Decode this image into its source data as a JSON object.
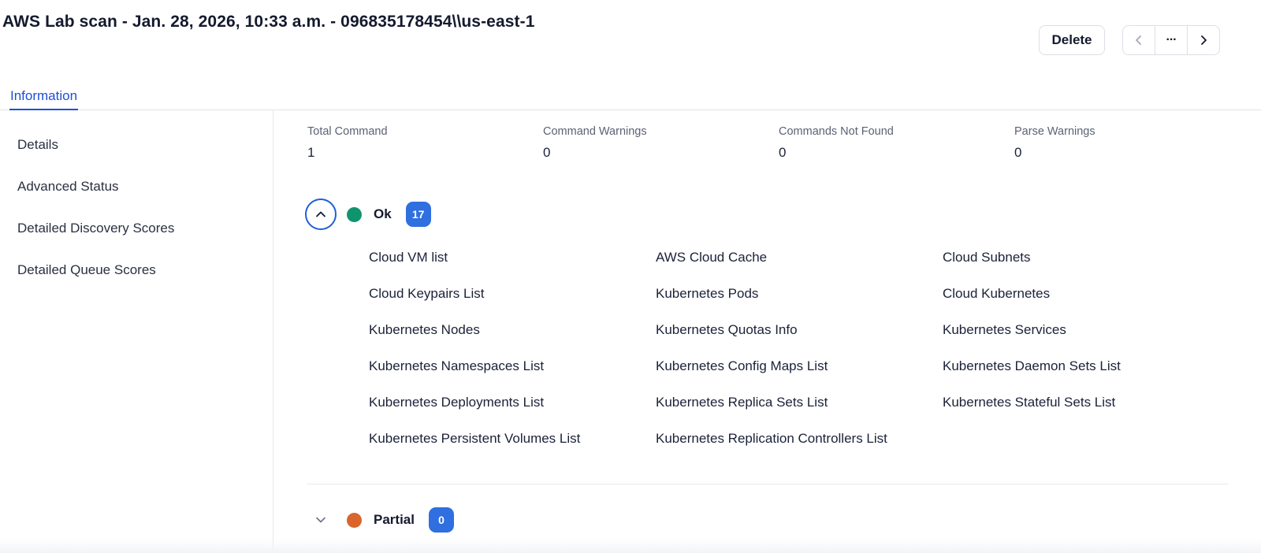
{
  "header": {
    "title": "AWS Lab scan - Jan. 28, 2026, 10:33 a.m. - 096835178454\\\\us-east-1",
    "delete_label": "Delete",
    "nav_prev_icon": "chevron-left-icon",
    "nav_more_icon": "more-horizontal-icon",
    "nav_more_glyph": "···",
    "nav_next_icon": "chevron-right-icon"
  },
  "tabs": [
    {
      "label": "Information",
      "active": true
    }
  ],
  "sidebar": {
    "items": [
      {
        "label": "Details"
      },
      {
        "label": "Advanced Status"
      },
      {
        "label": "Detailed Discovery Scores"
      },
      {
        "label": "Detailed Queue Scores"
      }
    ]
  },
  "stats": [
    {
      "label": "Total Command",
      "value": "1"
    },
    {
      "label": "Command Warnings",
      "value": "0"
    },
    {
      "label": "Commands Not Found",
      "value": "0"
    },
    {
      "label": "Parse Warnings",
      "value": "0"
    }
  ],
  "groups": [
    {
      "label": "Ok",
      "count": "17",
      "expanded": true,
      "status_color": "#10946d",
      "items": [
        "Cloud VM list",
        "AWS Cloud Cache",
        "Cloud Subnets",
        "Cloud Keypairs List",
        "Kubernetes Pods",
        "Cloud Kubernetes",
        "Kubernetes Nodes",
        "Kubernetes Quotas Info",
        "Kubernetes Services",
        "Kubernetes Namespaces List",
        "Kubernetes Config Maps List",
        "Kubernetes Daemon Sets List",
        "Kubernetes Deployments List",
        "Kubernetes Replica Sets List",
        "Kubernetes Stateful Sets List",
        "Kubernetes Persistent Volumes List",
        "Kubernetes Replication Controllers List"
      ]
    },
    {
      "label": "Partial",
      "count": "0",
      "expanded": false,
      "status_color": "#d9652a"
    }
  ],
  "colors": {
    "accent": "#1d4fd8",
    "badge": "#2f6fe0",
    "ok": "#10946d",
    "partial": "#d9652a"
  }
}
